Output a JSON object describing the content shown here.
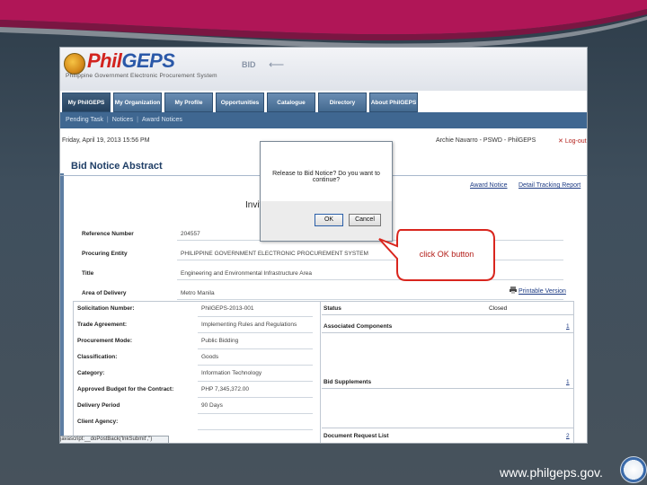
{
  "slide": {
    "footer_url": "www.philgeps.gov."
  },
  "banner": {
    "logo_phil": "Phil",
    "logo_geps": "GEPS",
    "logo_subtitle": "Philippine Government Electronic Procurement System",
    "section": "BID"
  },
  "tabs": [
    "My PhilGEPS",
    "My Organization",
    "My Profile",
    "Opportunities",
    "Catalogue",
    "Directory",
    "About PhilGEPS"
  ],
  "subnav": [
    "Pending Task",
    "Notices",
    "Award Notices"
  ],
  "infobar": {
    "datetime": "Friday, April 19, 2013 15:56 PM",
    "user": "Archie Navarro - PSWD - PhilGEPS",
    "logout": "Log-out"
  },
  "page": {
    "title": "Bid Notice Abstract",
    "award_link": "Award Notice",
    "print_link": "Detail Tracking Report",
    "notice_heading": "Invitation to Bid",
    "printable_link": "Printable Version"
  },
  "ref_rows": [
    {
      "label": "Reference Number",
      "value": "204557"
    },
    {
      "label": "Procuring Entity",
      "value": "PHILIPPINE GOVERNMENT ELECTRONIC PROCUREMENT SYSTEM"
    },
    {
      "label": "Title",
      "value": "Engineering and Environmental Infrastructure Area"
    },
    {
      "label": "Area of Delivery",
      "value": "Metro Manila"
    }
  ],
  "solicitation": [
    {
      "label": "Solicitation Number:",
      "value": "PhilGEPS-2013-001"
    },
    {
      "label": "Trade Agreement:",
      "value": "Implementing Rules and Regulations"
    },
    {
      "label": "Procurement Mode:",
      "value": "Public Bidding"
    },
    {
      "label": "Classification:",
      "value": "Goods"
    },
    {
      "label": "Category:",
      "value": "Information Technology"
    },
    {
      "label": "Approved Budget for the Contract:",
      "value": "PHP 7,345,372.00"
    },
    {
      "label": "Delivery Period",
      "value": "90 Days"
    },
    {
      "label": "Client Agency:",
      "value": ""
    }
  ],
  "right_sections": {
    "status_label": "Status",
    "status_value": "Closed",
    "associated_label": "Associated Components",
    "associated_count": "1",
    "supplements_label": "Bid Supplements",
    "supplements_count": "1",
    "doc_request_label": "Document Request List",
    "doc_request_count": "2"
  },
  "statusbar": "javascript:__doPostBack('lnkSubmit','')",
  "dialog": {
    "message": "Release to Bid Notice? Do you want to continue?",
    "ok_label": "OK",
    "cancel_label": "Cancel"
  },
  "callout": {
    "text": "click OK button",
    "color": "#b21b16"
  }
}
